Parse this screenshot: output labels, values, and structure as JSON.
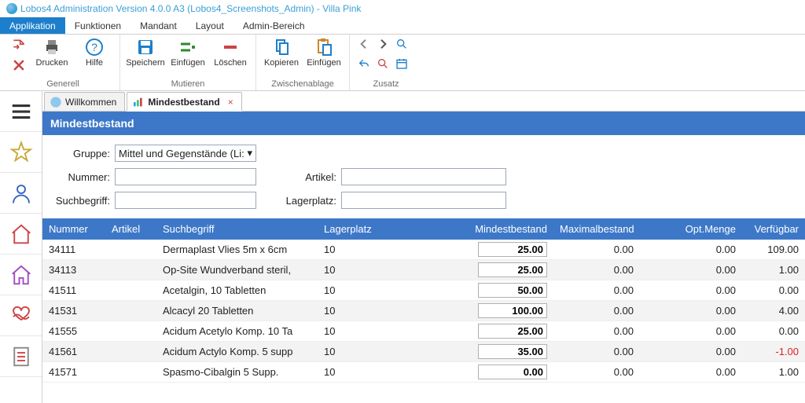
{
  "title": "Lobos4 Administration Version 4.0.0 A3 (Lobos4_Screenshots_Admin) - Villa Pink",
  "menu": {
    "items": [
      "Applikation",
      "Funktionen",
      "Mandant",
      "Layout",
      "Admin-Bereich"
    ],
    "active_index": 0
  },
  "ribbon": {
    "groups": [
      {
        "label": "Generell",
        "buttons": [
          {
            "id": "print",
            "label": "Drucken"
          },
          {
            "id": "help",
            "label": "Hilfe"
          }
        ]
      },
      {
        "label": "Mutieren",
        "buttons": [
          {
            "id": "save",
            "label": "Speichern"
          },
          {
            "id": "insert",
            "label": "Einfügen"
          },
          {
            "id": "delete",
            "label": "Löschen"
          }
        ]
      },
      {
        "label": "Zwischenablage",
        "buttons": [
          {
            "id": "copy",
            "label": "Kopieren"
          },
          {
            "id": "paste",
            "label": "Einfügen"
          }
        ]
      },
      {
        "label": "Zusatz",
        "buttons": []
      }
    ]
  },
  "tabs": {
    "items": [
      {
        "label": "Willkommen",
        "closable": false
      },
      {
        "label": "Mindestbestand",
        "closable": true
      }
    ],
    "active_index": 1
  },
  "panel": {
    "title": "Mindestbestand"
  },
  "filters": {
    "gruppe_label": "Gruppe:",
    "gruppe_value": "Mittel und Gegenstände (Li:",
    "nummer_label": "Nummer:",
    "nummer_value": "",
    "suchbegriff_label": "Suchbegriff:",
    "suchbegriff_value": "",
    "artikel_label": "Artikel:",
    "artikel_value": "",
    "lagerplatz_label": "Lagerplatz:",
    "lagerplatz_value": ""
  },
  "table": {
    "headers": {
      "nummer": "Nummer",
      "artikel": "Artikel",
      "such": "Suchbegriff",
      "lager": "Lagerplatz",
      "min": "Mindestbestand",
      "max": "Maximalbestand",
      "opt": "Opt.Menge",
      "verf": "Verfügbar"
    },
    "rows": [
      {
        "nummer": "34111",
        "artikel": "",
        "such": "Dermaplast Vlies 5m x 6cm",
        "lager": "10",
        "min": "25.00",
        "max": "0.00",
        "opt": "0.00",
        "verf": "109.00"
      },
      {
        "nummer": "34113",
        "artikel": "",
        "such": "Op-Site Wundverband steril,",
        "lager": "10",
        "min": "25.00",
        "max": "0.00",
        "opt": "0.00",
        "verf": "1.00"
      },
      {
        "nummer": "41511",
        "artikel": "",
        "such": "Acetalgin, 10 Tabletten",
        "lager": "10",
        "min": "50.00",
        "max": "0.00",
        "opt": "0.00",
        "verf": "0.00"
      },
      {
        "nummer": "41531",
        "artikel": "",
        "such": "Alcacyl 20 Tabletten",
        "lager": "10",
        "min": "100.00",
        "max": "0.00",
        "opt": "0.00",
        "verf": "4.00"
      },
      {
        "nummer": "41555",
        "artikel": "",
        "such": "Acidum Acetylo Komp. 10 Ta",
        "lager": "10",
        "min": "25.00",
        "max": "0.00",
        "opt": "0.00",
        "verf": "0.00"
      },
      {
        "nummer": "41561",
        "artikel": "",
        "such": "Acidum Actylo Komp. 5 supp",
        "lager": "10",
        "min": "35.00",
        "max": "0.00",
        "opt": "0.00",
        "verf": "-1.00"
      },
      {
        "nummer": "41571",
        "artikel": "",
        "such": "Spasmo-Cibalgin 5 Supp.",
        "lager": "10",
        "min": "0.00",
        "max": "0.00",
        "opt": "0.00",
        "verf": "1.00"
      }
    ]
  }
}
